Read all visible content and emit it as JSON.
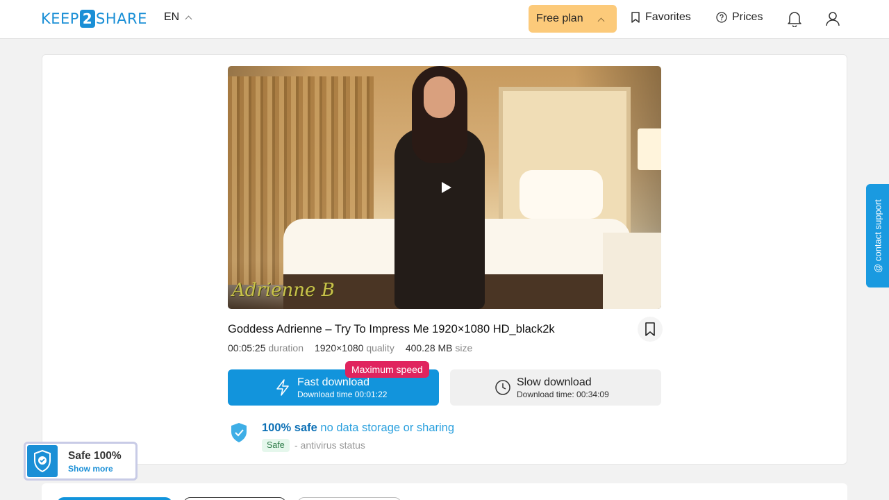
{
  "header": {
    "logo_left": "KEEP",
    "logo_num": "2",
    "logo_right": "SHARE",
    "language": "EN",
    "plan_label": "Free plan",
    "favorites_label": "Favorites",
    "prices_label": "Prices"
  },
  "video": {
    "watermark": "Adrienne B",
    "title": "Goddess Adrienne – Try To Impress Me 1920×1080 HD_black2k",
    "duration_value": "00:05:25",
    "duration_label": "duration",
    "quality_value": "1920×1080",
    "quality_label": "quality",
    "size_value": "400.28 MB",
    "size_label": "size"
  },
  "download": {
    "fast_label": "Fast download",
    "fast_time": "Download time 00:01:22",
    "badge": "Maximum speed",
    "slow_label": "Slow download",
    "slow_time": "Download time: 00:34:09"
  },
  "safety": {
    "strong": "100% safe",
    "light": "no data storage or sharing",
    "badge": "Safe",
    "status": "- antivirus status"
  },
  "support": {
    "label": "@ contact support"
  },
  "safe_widget": {
    "title": "Safe 100%",
    "link": "Show more"
  },
  "colors": {
    "accent": "#1294dc",
    "plan": "#fcca7a",
    "badge": "#e0245e",
    "safe_green": "#2d7b48"
  }
}
